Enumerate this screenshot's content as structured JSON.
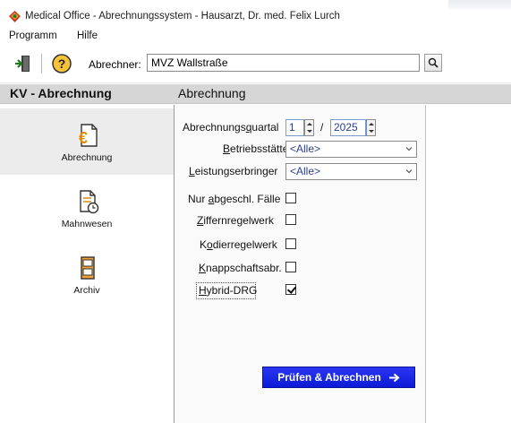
{
  "window": {
    "title": "Medical Office - Abrechnungssystem - Hausarzt, Dr. med. Felix Lurch"
  },
  "menu": {
    "items": [
      "Programm",
      "Hilfe"
    ]
  },
  "toolbar": {
    "abrechner_label": "Abrechner:",
    "abrechner_value": "MVZ Wallstraße"
  },
  "header": {
    "left_title": "KV - Abrechnung",
    "right_title": "Abrechnung"
  },
  "sidebar": {
    "items": [
      {
        "label": "Abrechnung",
        "icon": "euro-document-icon",
        "active": true
      },
      {
        "label": "Mahnwesen",
        "icon": "document-clock-icon",
        "active": false
      },
      {
        "label": "Archiv",
        "icon": "archive-box-icon",
        "active": false
      }
    ]
  },
  "form": {
    "quartal_label_pre": "Abrechnungs",
    "quartal_label_u": "q",
    "quartal_label_post": "uartal",
    "quartal_value": "1",
    "slash": "/",
    "year_value": "2025",
    "betriebsstaette_label_u": "B",
    "betriebsstaette_label_post": "etriebsstätte",
    "betriebsstaette_value": "<Alle>",
    "leistung_label_u": "L",
    "leistung_label_post": "eistungserbringer",
    "leistung_value": "<Alle>",
    "nur_label_pre": "Nur ",
    "nur_label_u": "a",
    "nur_label_post": "bgeschl. Fälle",
    "nur_checked": false,
    "ziffern_label_u": "Z",
    "ziffern_label_post": "iffernregelwerk",
    "ziffern_checked": false,
    "kodier_label_pre": "K",
    "kodier_label_u": "o",
    "kodier_label_post": "dierregelwerk",
    "kodier_checked": false,
    "knapp_label_u": "K",
    "knapp_label_post": "nappschaftsabr.",
    "knapp_checked": false,
    "hybrid_label_u": "H",
    "hybrid_label_post": "ybrid-DRG",
    "hybrid_checked": true,
    "submit_label": "Prüfen & Abrechnen"
  },
  "colors": {
    "accent": "#0c1bd6",
    "header_bg": "#d6d6d6",
    "value_text": "#2b3e8f"
  }
}
